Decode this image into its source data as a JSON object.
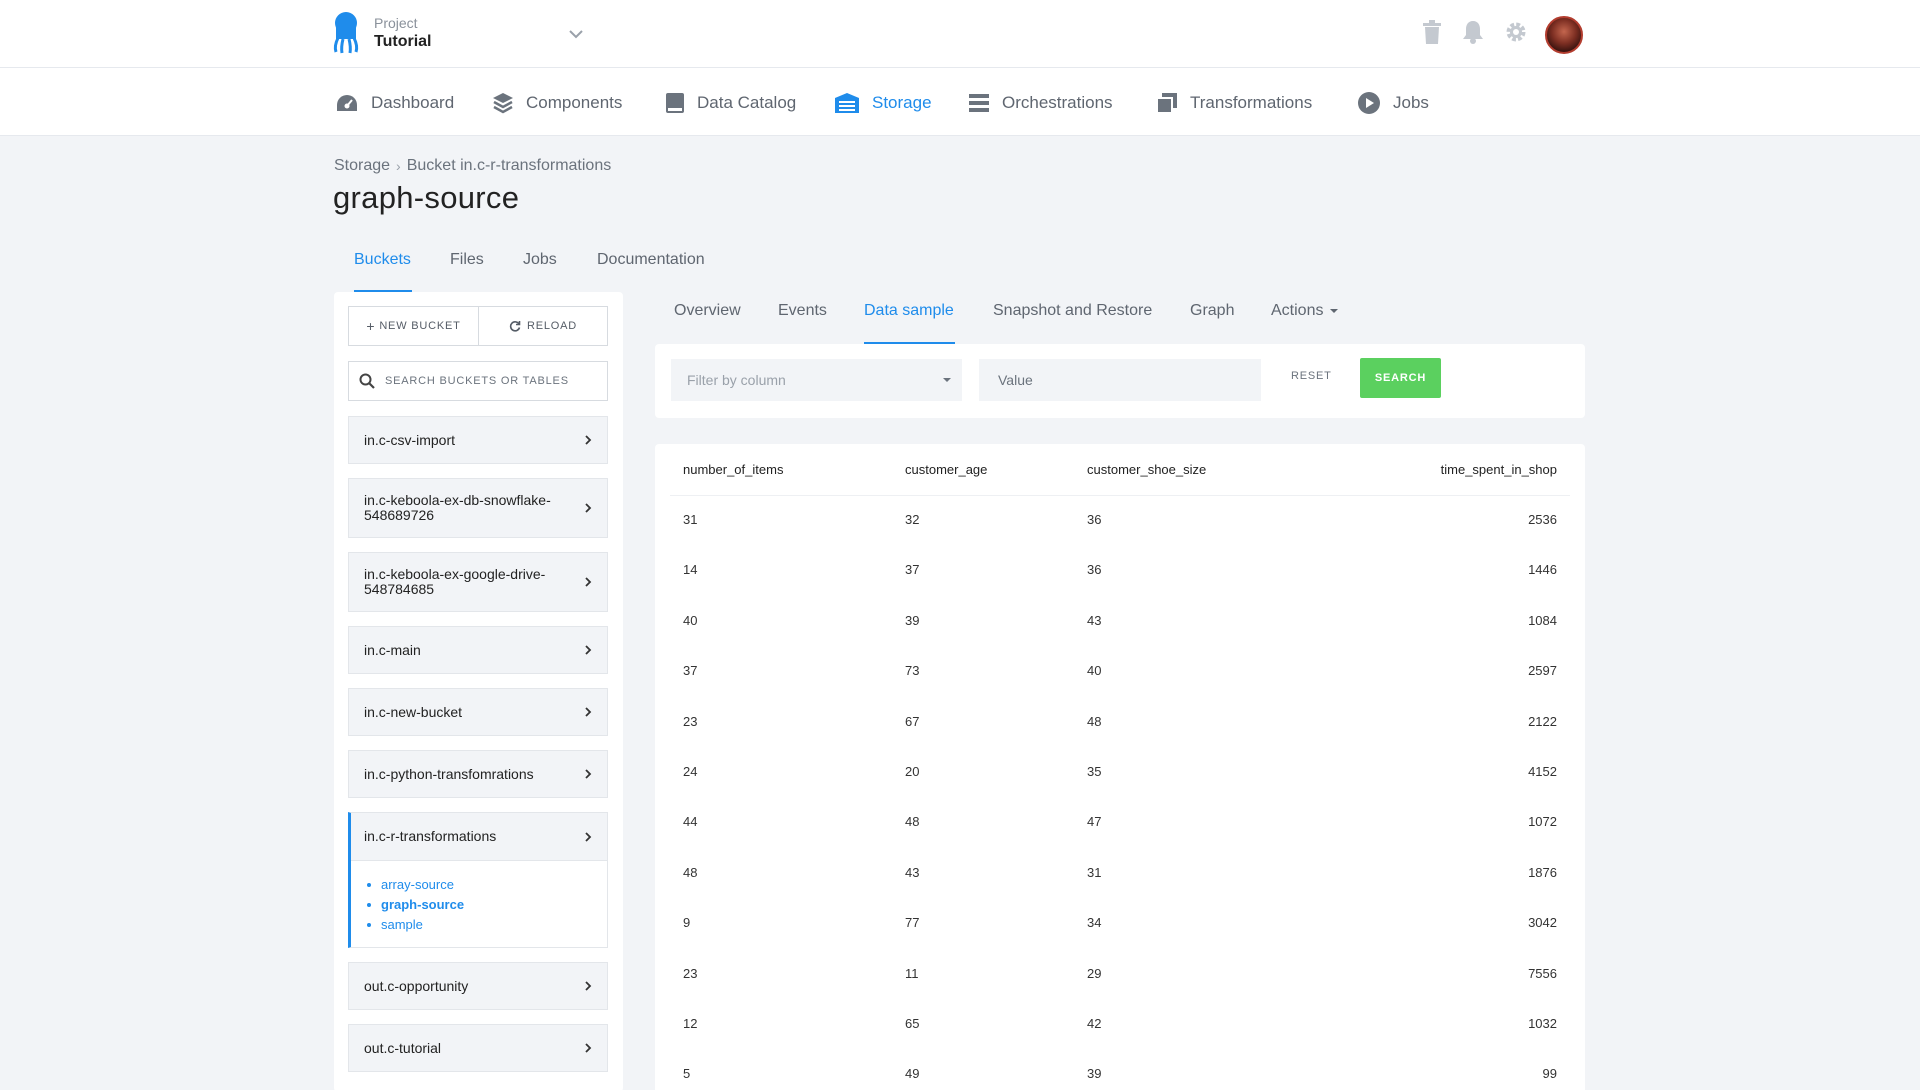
{
  "project": {
    "label": "Project",
    "name": "Tutorial"
  },
  "nav": [
    {
      "label": "Dashboard",
      "icon": "gauge-icon"
    },
    {
      "label": "Components",
      "icon": "layers-icon"
    },
    {
      "label": "Data Catalog",
      "icon": "book-icon"
    },
    {
      "label": "Storage",
      "icon": "storage-icon",
      "active": true
    },
    {
      "label": "Orchestrations",
      "icon": "list-icon"
    },
    {
      "label": "Transformations",
      "icon": "copy-icon"
    },
    {
      "label": "Jobs",
      "icon": "play-icon"
    }
  ],
  "breadcrumb": {
    "root": "Storage",
    "current": "Bucket in.c-r-transformations"
  },
  "page_title": "graph-source",
  "main_tabs": [
    "Buckets",
    "Files",
    "Jobs",
    "Documentation"
  ],
  "sidebar": {
    "new_bucket": "NEW BUCKET",
    "reload": "RELOAD",
    "search_placeholder": "SEARCH BUCKETS OR TABLES",
    "buckets": [
      "in.c-csv-import",
      "in.c-keboola-ex-db-snowflake-548689726",
      "in.c-keboola-ex-google-drive-548784685",
      "in.c-main",
      "in.c-new-bucket",
      "in.c-python-transfomrations",
      "in.c-r-transformations",
      "out.c-opportunity",
      "out.c-tutorial"
    ],
    "open_bucket_tables": [
      "array-source",
      "graph-source",
      "sample"
    ]
  },
  "sub_tabs": [
    "Overview",
    "Events",
    "Data sample",
    "Snapshot and Restore",
    "Graph",
    "Actions"
  ],
  "filter": {
    "column_placeholder": "Filter by column",
    "value_placeholder": "Value",
    "reset": "RESET",
    "search": "SEARCH"
  },
  "table": {
    "headers": [
      "number_of_items",
      "customer_age",
      "customer_shoe_size",
      "time_spent_in_shop"
    ],
    "rows": [
      [
        "31",
        "32",
        "36",
        "2536"
      ],
      [
        "14",
        "37",
        "36",
        "1446"
      ],
      [
        "40",
        "39",
        "43",
        "1084"
      ],
      [
        "37",
        "73",
        "40",
        "2597"
      ],
      [
        "23",
        "67",
        "48",
        "2122"
      ],
      [
        "24",
        "20",
        "35",
        "4152"
      ],
      [
        "44",
        "48",
        "47",
        "1072"
      ],
      [
        "48",
        "43",
        "31",
        "1876"
      ],
      [
        "9",
        "77",
        "34",
        "3042"
      ],
      [
        "23",
        "11",
        "29",
        "7556"
      ],
      [
        "12",
        "65",
        "42",
        "1032"
      ],
      [
        "5",
        "49",
        "39",
        "99"
      ]
    ]
  },
  "colors": {
    "accent": "#1f8ceb",
    "success": "#5bd05f",
    "background": "#f2f4f7"
  }
}
